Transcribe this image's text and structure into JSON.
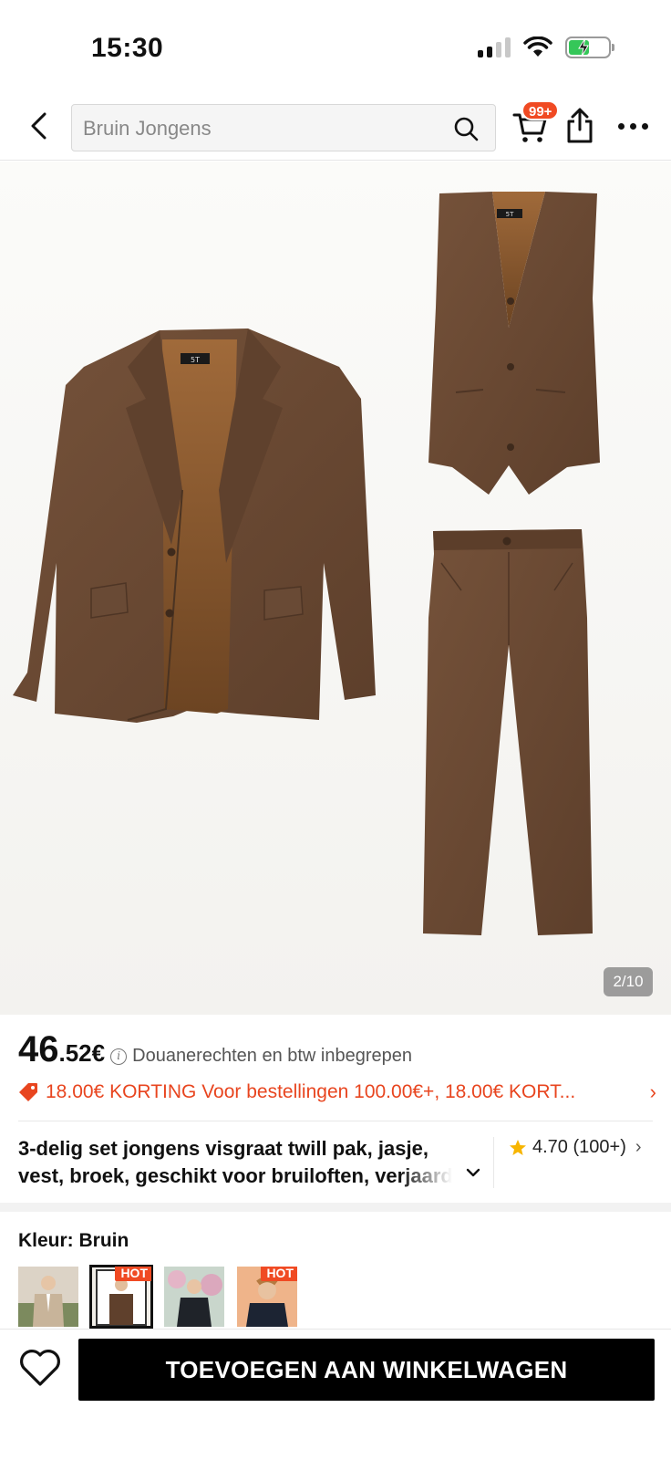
{
  "status_bar": {
    "time": "15:30"
  },
  "nav": {
    "search_placeholder": "Bruin Jongens",
    "cart_badge": "99+"
  },
  "gallery": {
    "counter": "2/10"
  },
  "price": {
    "integer": "46",
    "decimal": ".52",
    "currency": "€",
    "note": "Douanerechten en btw inbegrepen"
  },
  "discount": {
    "text": "18.00€ KORTING Voor bestellingen 100.00€+,  18.00€ KORT..."
  },
  "product": {
    "title_line1": "3-delig set jongens visgraat twill pak, jasje,",
    "title_line2": "vest, broek, geschikt voor bruiloften, verjaardagen"
  },
  "rating": {
    "value": "4.70",
    "count": "(100+)"
  },
  "color": {
    "label": "Kleur: Bruin",
    "swatches": [
      {
        "hot": ""
      },
      {
        "hot": "HOT"
      },
      {
        "hot": ""
      },
      {
        "hot": "HOT"
      }
    ]
  },
  "actions": {
    "add_to_cart": "TOEVOEGEN AAN WINKELWAGEN"
  },
  "colors": {
    "accent": "#f04a23",
    "fabric": "#6b4a32",
    "lining": "#8a5a30"
  }
}
